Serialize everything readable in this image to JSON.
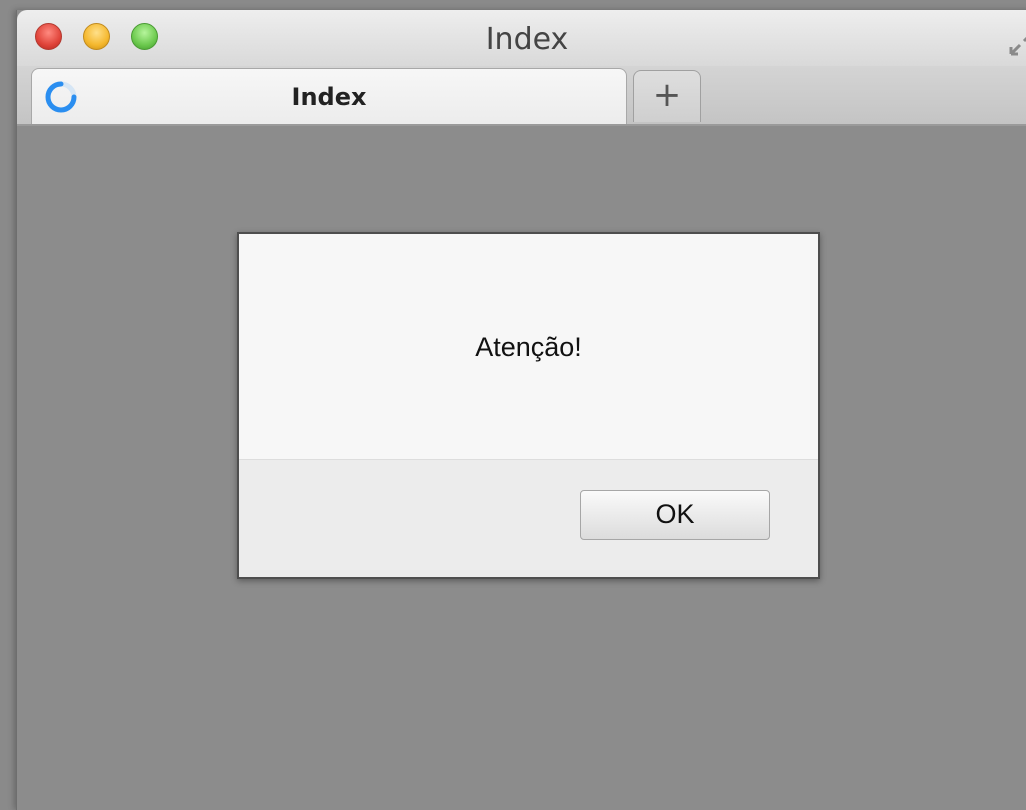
{
  "window": {
    "title": "Index"
  },
  "tabs": [
    {
      "label": "Index",
      "active": true,
      "icon": "loading-spinner-icon"
    }
  ],
  "new_tab": {
    "label": "+",
    "icon": "plus-icon"
  },
  "dialog": {
    "message": "Atenção!",
    "ok_label": "OK"
  },
  "colors": {
    "close": "#e0443a",
    "minimize": "#f5b82e",
    "maximize": "#6cc94e",
    "spinner": "#2a8ef0",
    "backdrop": "#8c8c8c"
  }
}
